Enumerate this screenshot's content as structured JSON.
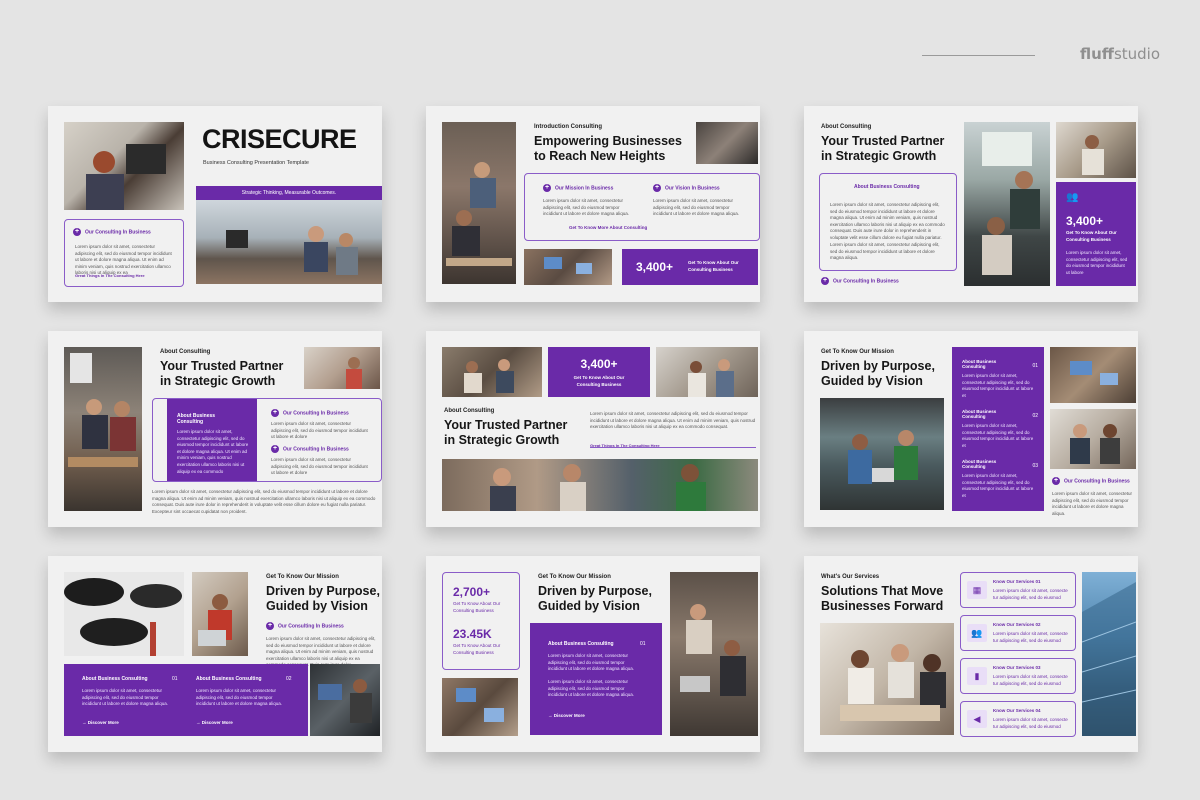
{
  "brand": {
    "prefix": "fluff",
    "suffix": "studio"
  },
  "slides": {
    "s1": {
      "title": "CRISECURE",
      "subtitle": "Business Consulting Presentation Template",
      "banner": "Strategic Thinking, Measurable Outcomes.",
      "link": "Our Consulting In Business",
      "body": "Lorem ipsum dolor sit amet, consectetur adipiscing elit, sed do eiusmod tempor incididunt ut labore et dolore magna aliqua. Ut enim ad minim veniam, quis nostrud exercitation ullamco laboris nisi ut aliquip ex ea",
      "footer": "Great Things In The Consulting Here"
    },
    "s2": {
      "eyebrow": "Introduction Consulting",
      "title1": "Empowering Businesses",
      "title2": "to Reach New Heights",
      "mission": "Our Mission In Business",
      "vision": "Our Vision In Business",
      "body1": "Lorem ipsum dolor sit amet, consectetur adipiscing elit, sed do eiusmod tempor incididunt ut labore et dolore magna aliqua.",
      "body2": "Lorem ipsum dolor sit amet, consectetur adipiscing elit, sed do eiusmod tempor incididunt ut labore et dolore magna aliqua.",
      "cta": "Get To Know More About Consulting",
      "stat": "3,400+",
      "stat_label": "Get To Know About Our Consulting Business"
    },
    "s3": {
      "eyebrow": "About Consulting",
      "title1": "Your Trusted Partner",
      "title2": "in Strategic Growth",
      "box_label": "About Business Consulting",
      "body1": "Lorem ipsum dolor sit amet, consectetur adipiscing elit, sed do eiusmod tempor incididunt ut labore et dolore magna aliqua. Ut enim ad minim veniam, quis nostrud exercitation ullamco laboris nisi ut aliquip ex ea commodo consequat. Duis aute irure dolor in reprehenderit in voluptate velit esse cillum dolore eu fugiat nulla pariatur.",
      "body2": "Lorem ipsum dolor sit amet, consectetur adipiscing elit, sed do eiusmod tempor incididunt ut labore et dolore magna aliqua.",
      "link": "Our Consulting In Business",
      "stat": "3,400+",
      "stat_label": "Get To Know About Our Consulting Business",
      "stat_body": "Lorem ipsum dolor sit amet, consectetur adipiscing elit, sed do eiusmod tempor incididunt ut labore"
    },
    "s4": {
      "eyebrow": "About Consulting",
      "title1": "Your Trusted Partner",
      "title2": "in Strategic Growth",
      "box_title": "About Business Consulting",
      "box_body": "Lorem ipsum dolor sit amet, consectetur adipiscing elit, sed do eiusmod tempor incididunt ut labore et dolore magna aliqua. Ut enim ad minim veniam, quis nostrud exercitation ullamco laboris nisi ut aliquip ex ea commodo",
      "link1": "Our Consulting In Business",
      "body1": "Lorem ipsum dolor sit amet, consectetur adipiscing elit, sed do eiusmod tempor incididunt ut labore et dolore",
      "link2": "Our Consulting In Business",
      "body2": "Lorem ipsum dolor sit amet, consectetur adipiscing elit, sed do eiusmod tempor incididunt ut labore et dolore",
      "footer": "Lorem ipsum dolor sit amet, consectetur adipiscing elit, sed do eiusmod tempor incididunt ut labore et dolore magna aliqua. Ut enim ad minim veniam, quis nostrud exercitation ullamco laboris nisi ut aliquip ex ea commodo consequat. Duis aute irure dolor in reprehenderit in voluptate velit esse cillum dolore eu fugiat nulla pariatur. Excepteur sint occaecat cupidatat non proident."
    },
    "s5": {
      "stat": "3,400+",
      "stat_label": "Get To Know About Our Consulting Business",
      "eyebrow": "About Consulting",
      "title1": "Your Trusted Partner",
      "title2": "in Strategic Growth",
      "body": "Lorem ipsum dolor sit amet, consectetur adipiscing elit, sed do eiusmod tempor incididunt ut labore et dolore magna aliqua. Ut enim ad minim veniam, quis nostrud exercitation ullamco laboris nisi ut aliquip ex ea commodo consequat.",
      "link": "Great Things In The Consulting Here"
    },
    "s6": {
      "eyebrow": "Get To Know Our Mission",
      "title1": "Driven by Purpose,",
      "title2": "Guided by Vision",
      "body": "Lorem ipsum dolor sit amet, consectetur adipiscing elit, sed do eiusmod tempor incididunt ut labore et dolore magna aliqua. Ut enim ad minim veniam, quis nostrud exercitation ullamco laboris nisi ut aliquip ex ea commodo consequat.",
      "items": [
        {
          "label": "About Business Consulting",
          "num": "01",
          "body": "Lorem ipsum dolor sit amet, consectetur adipiscing elit, sed do eiusmod tempor incididunt ut labore et"
        },
        {
          "label": "About Business Consulting",
          "num": "02",
          "body": "Lorem ipsum dolor sit amet, consectetur adipiscing elit, sed do eiusmod tempor incididunt ut labore et"
        },
        {
          "label": "About Business Consulting",
          "num": "03",
          "body": "Lorem ipsum dolor sit amet, consectetur adipiscing elit, sed do eiusmod tempor incididunt ut labore et"
        }
      ],
      "link": "Our Consulting In Business",
      "link_body": "Lorem ipsum dolor sit amet, consectetur adipiscing elit, sed do eiusmod tempor incididunt ut labore et dolore magna aliqua."
    },
    "s7": {
      "eyebrow": "Get To Know Our Mission",
      "title1": "Driven by Purpose,",
      "title2": "Guided by Vision",
      "link": "Our Consulting In Business",
      "body": "Lorem ipsum dolor sit amet, consectetur adipiscing elit, sed do eiusmod tempor incididunt ut labore et dolore magna aliqua. Ut enim ad minim veniam, quis nostrud exercitation ullamco laboris nisi ut aliquip ex ea commodo consequat. Duis aute irure dolor.",
      "col1": {
        "label": "About Business Consulting",
        "num": "01",
        "body": "Lorem ipsum dolor sit amet, consectetur adipiscing elit, sed do eiusmod tempor incididunt ut labore et dolore magna aliqua.",
        "more": "Discover More"
      },
      "col2": {
        "label": "About Business Consulting",
        "num": "02",
        "body": "Lorem ipsum dolor sit amet, consectetur adipiscing elit, sed do eiusmod tempor incididunt ut labore et dolore magna aliqua.",
        "more": "Discover More"
      }
    },
    "s8": {
      "stat1": "2,700+",
      "stat1_label": "Get To Know About Our Consulting Business",
      "stat2": "23.45K",
      "stat2_label": "Get To Know About Our Consulting Business",
      "eyebrow": "Get To Know Our Mission",
      "title1": "Driven by Purpose,",
      "title2": "Guided by Vision",
      "box_label": "About Business Consulting",
      "box_num": "01",
      "body1": "Lorem ipsum dolor sit amet, consectetur adipiscing elit, sed do eiusmod tempor incididunt ut labore et dolore magna aliqua.",
      "body2": "Lorem ipsum dolor sit amet, consectetur adipiscing elit, sed do eiusmod tempor incididunt ut labore et dolore magna aliqua.",
      "more": "Discover More"
    },
    "s9": {
      "eyebrow": "What's Our Services",
      "title1": "Solutions That Move",
      "title2": "Businesses Forward",
      "services": [
        {
          "label": "Know Our Services 01",
          "body": "Lorem ipsum dolor sit amet, consecte tur adipiscing elit, sed do eiusmod",
          "icon": "calendar-icon"
        },
        {
          "label": "Know Our Services 02",
          "body": "Lorem ipsum dolor sit amet, consecte tur adipiscing elit, sed do eiusmod",
          "icon": "team-icon"
        },
        {
          "label": "Know Our Services 03",
          "body": "Lorem ipsum dolor sit amet, consecte tur adipiscing elit, sed do eiusmod",
          "icon": "chart-icon"
        },
        {
          "label": "Know Our Services 04",
          "body": "Lorem ipsum dolor sit amet, consecte tur adipiscing elit, sed do eiusmod",
          "icon": "megaphone-icon"
        }
      ]
    }
  },
  "colors": {
    "accent": "#6a2aa8",
    "background": "#e4e4e4",
    "slide": "#f1f1f1"
  }
}
